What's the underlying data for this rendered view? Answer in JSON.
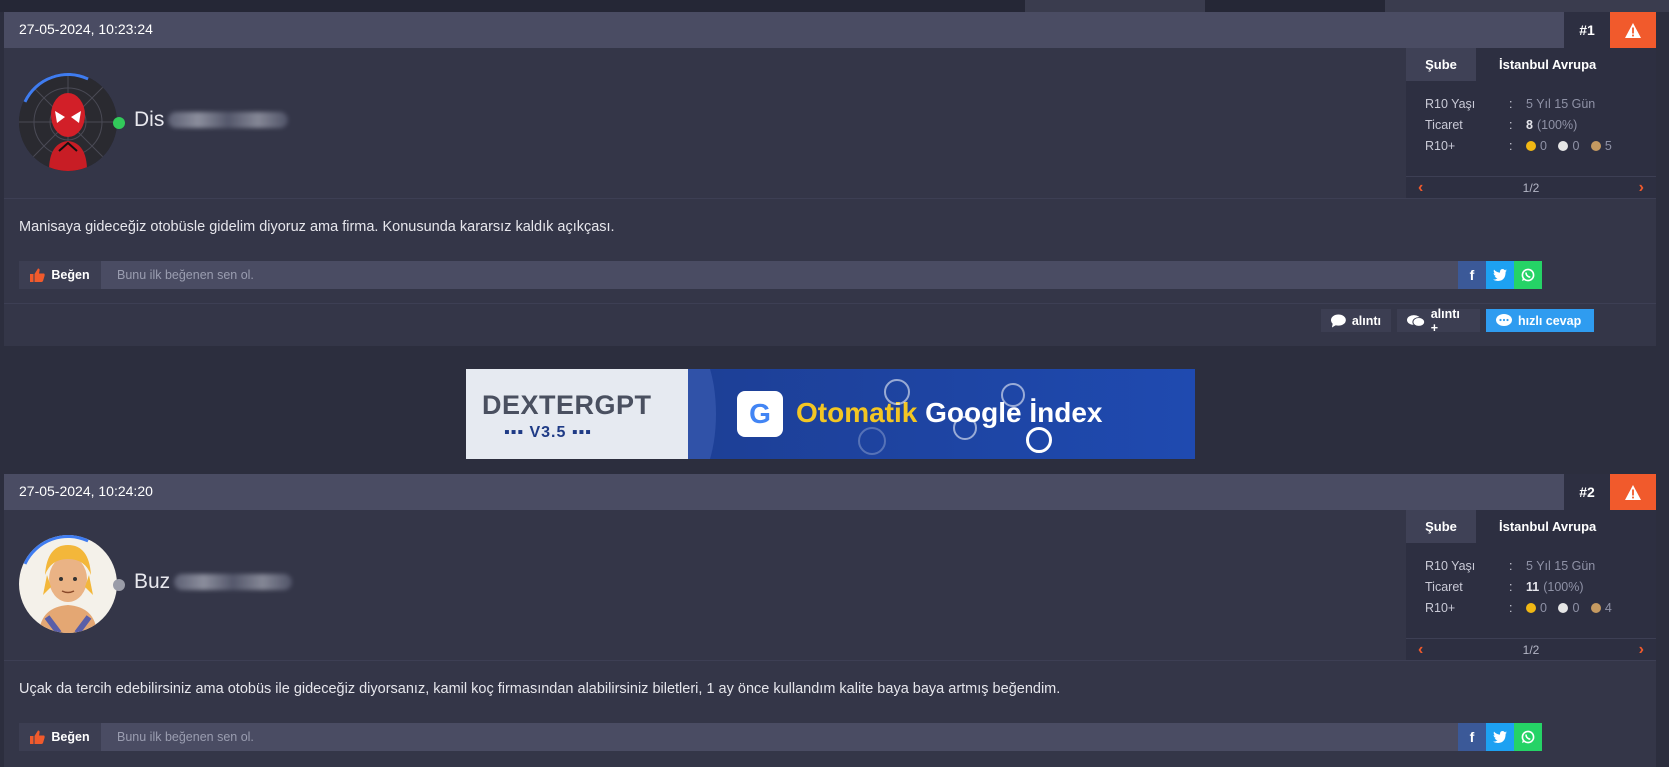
{
  "colors": {
    "accent_orange": "#f15a2c",
    "online_green": "#32c95a",
    "offline_gray": "#9a9ca8",
    "reply_blue": "#2f9cf0",
    "facebook": "#3b5998",
    "twitter": "#1da1f2",
    "whatsapp": "#25d366",
    "coin_gold": "#f1b814",
    "coin_silver": "#e6e6e6",
    "coin_bronze": "#c59a61"
  },
  "posts": [
    {
      "date": "27-05-2024, 10:23:24",
      "number": "#1",
      "username_visible": "Dis",
      "status": "online",
      "info": {
        "tab_label": "Şube",
        "tab_value": "İstanbul Avrupa",
        "rows": [
          {
            "key": "R10 Yaşı",
            "sep": ":",
            "value": "5 Yıl 15 Gün"
          },
          {
            "key": "Ticaret",
            "sep": ":",
            "value_bold": "8",
            "value_rest": "(100%)"
          },
          {
            "key": "R10+",
            "sep": ":",
            "gold": "0",
            "silver": "0",
            "bronze": "5"
          }
        ],
        "pager": "1/2"
      },
      "text": "Manisaya gideceğiz otobüsle gidelim diyoruz ama firma. Konusunda kararsız kaldık açıkçası.",
      "like_label": "Beğen",
      "like_text": "Bunu ilk beğenen sen ol."
    },
    {
      "date": "27-05-2024, 10:24:20",
      "number": "#2",
      "username_visible": "Buz",
      "status": "offline",
      "info": {
        "tab_label": "Şube",
        "tab_value": "İstanbul Avrupa",
        "rows": [
          {
            "key": "R10 Yaşı",
            "sep": ":",
            "value": "5 Yıl 15 Gün"
          },
          {
            "key": "Ticaret",
            "sep": ":",
            "value_bold": "11",
            "value_rest": "(100%)"
          },
          {
            "key": "R10+",
            "sep": ":",
            "gold": "0",
            "silver": "0",
            "bronze": "4"
          }
        ],
        "pager": "1/2"
      },
      "text": "Uçak da tercih edebilirsiniz ama otobüs ile gideceğiz diyorsanız, kamil koç firmasından alabilirsiniz biletleri, 1 ay önce kullandım kalite baya baya artmış beğendim.",
      "like_label": "Beğen",
      "like_text": "Bunu ilk beğenen sen ol."
    }
  ],
  "footer_actions": {
    "quote": "alıntı",
    "multi_quote": "alıntı +",
    "quick_reply": "hızlı cevap"
  },
  "share_icons": [
    "facebook-icon",
    "twitter-icon",
    "whatsapp-icon"
  ],
  "banner": {
    "brand": "DEXTERGPT",
    "version": "▪▪▪ V3.5 ▪▪▪",
    "g_letter": "G",
    "title_yellow": "Otomatik",
    "title_white": "Google İndex"
  }
}
